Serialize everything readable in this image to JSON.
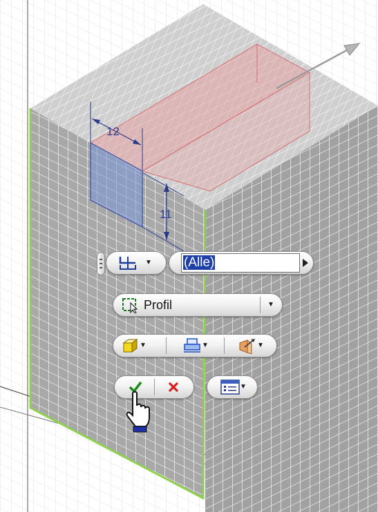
{
  "model": {
    "dimension_width": "12",
    "dimension_height": "11"
  },
  "minitoolbar": {
    "selection_filter_value": "(Alle)",
    "profile_dropdown_label": "Profil",
    "icons": {
      "grip": "grip-handle-icon",
      "selection_filter": "selection-filter-icon",
      "expand": "play-arrow-icon",
      "profile_select": "profile-select-icon",
      "solid_box": "solid-box-icon",
      "termination": "termination-icon",
      "direction": "direction-flip-icon",
      "ok": "checkmark-icon",
      "cancel": "cancel-x-icon",
      "options_list": "list-options-icon",
      "cursor": "hand-pointer-icon"
    },
    "colors": {
      "ok_green": "#1a8a1a",
      "cancel_red": "#d42020",
      "selection_blue": "#1e3fa8",
      "edge_green": "#8fd14f"
    }
  }
}
